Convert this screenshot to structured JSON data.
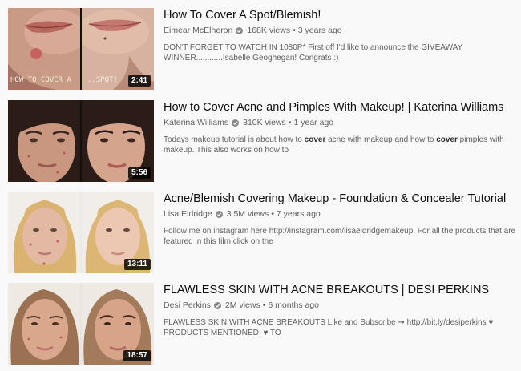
{
  "results": [
    {
      "title": "How To Cover A Spot/Blemish!",
      "channel": "Eimear McElheron",
      "views": "168K views",
      "age": "3 years ago",
      "description_parts": [
        {
          "text": "DON'T FORGET TO WATCH IN 1080P* First off I'd like to announce the GIVEAWAY WINNER............Isabelle Geoghegan! Congrats :)",
          "bold": false
        }
      ],
      "duration": "2:41",
      "thumb_text_left": "HOW TO COVER A",
      "thumb_text_right": "..SPOT!"
    },
    {
      "title": "How to Cover Acne and Pimples With Makeup! | Katerina Williams",
      "channel": "Katerina Williams",
      "views": "310K views",
      "age": "1 year ago",
      "description_parts": [
        {
          "text": "Todays makeup tutorial is about how to ",
          "bold": false
        },
        {
          "text": "cover",
          "bold": true
        },
        {
          "text": " acne with makeup and how to ",
          "bold": false
        },
        {
          "text": "cover",
          "bold": true
        },
        {
          "text": " pimples with makeup. This also works on how to",
          "bold": false
        }
      ],
      "duration": "5:56"
    },
    {
      "title": "Acne/Blemish Covering Makeup - Foundation & Concealer Tutorial",
      "channel": "Lisa Eldridge",
      "views": "3.5M views",
      "age": "7 years ago",
      "description_parts": [
        {
          "text": "Follow me on instagram here http://instagram.com/lisaeldridgemakeup. For all the products that are featured in this film click on the",
          "bold": false
        }
      ],
      "duration": "13:11"
    },
    {
      "title": "FLAWLESS SKIN WITH ACNE BREAKOUTS | DESI PERKINS",
      "channel": "Desi Perkins",
      "views": "2M views",
      "age": "6 months ago",
      "description_parts": [
        {
          "text": "FLAWLESS SKIN WITH ACNE BREAKOUTS Like and Subscribe ➞ http://bit.ly/desiperkins ♥ PRODUCTS MENTIONED: ♥ TO",
          "bold": false
        }
      ],
      "duration": "18:57"
    }
  ],
  "separator": "•",
  "icons": {
    "verified": "verified-check-icon"
  },
  "colors": {
    "title": "#0f0f0f",
    "meta": "#606060",
    "background": "#f9f9f9"
  }
}
